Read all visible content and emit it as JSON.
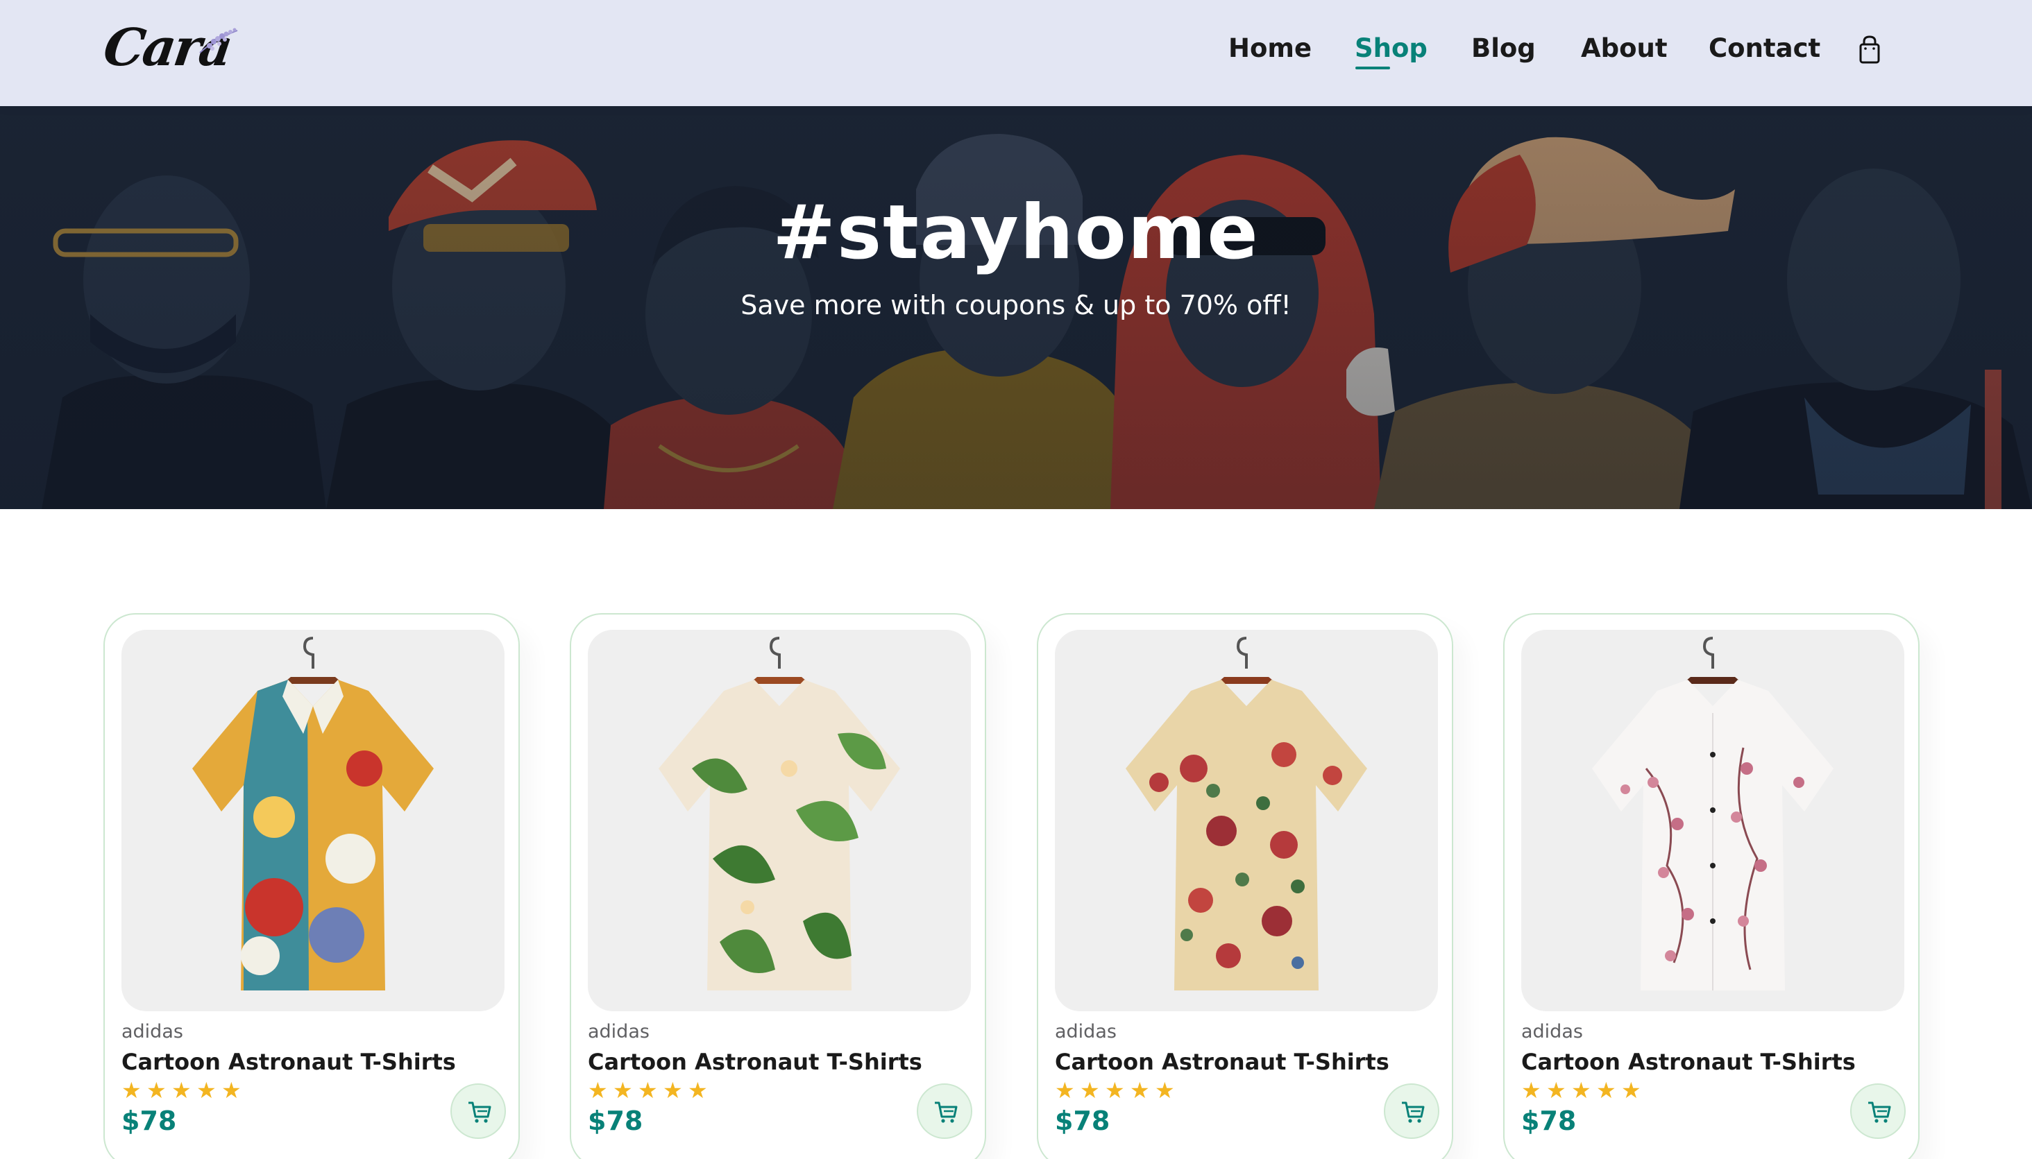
{
  "header": {
    "logo_text": "Cara",
    "nav": [
      {
        "label": "Home",
        "active": false
      },
      {
        "label": "Shop",
        "active": true
      },
      {
        "label": "Blog",
        "active": false
      },
      {
        "label": "About",
        "active": false
      },
      {
        "label": "Contact",
        "active": false
      }
    ],
    "cart_icon": "shopping-bag-icon"
  },
  "hero": {
    "title": "#stayhome",
    "subtitle": "Save more with coupons & up to 70% off!"
  },
  "products": [
    {
      "brand": "adidas",
      "name": "Cartoon Astronaut T-Shirts",
      "rating": 5,
      "price": "$78",
      "image": "shirt-colorful-abstract"
    },
    {
      "brand": "adidas",
      "name": "Cartoon Astronaut T-Shirts",
      "rating": 5,
      "price": "$78",
      "image": "shirt-green-leaf-floral"
    },
    {
      "brand": "adidas",
      "name": "Cartoon Astronaut T-Shirts",
      "rating": 5,
      "price": "$78",
      "image": "shirt-beige-rose-floral"
    },
    {
      "brand": "adidas",
      "name": "Cartoon Astronaut T-Shirts",
      "rating": 5,
      "price": "$78",
      "image": "shirt-white-cherry-blossom"
    }
  ],
  "colors": {
    "header_bg": "#e3e6f3",
    "accent": "#088178",
    "star": "#f3b521",
    "card_border": "#cce7d0",
    "cart_btn_bg": "#e8f6ea"
  }
}
